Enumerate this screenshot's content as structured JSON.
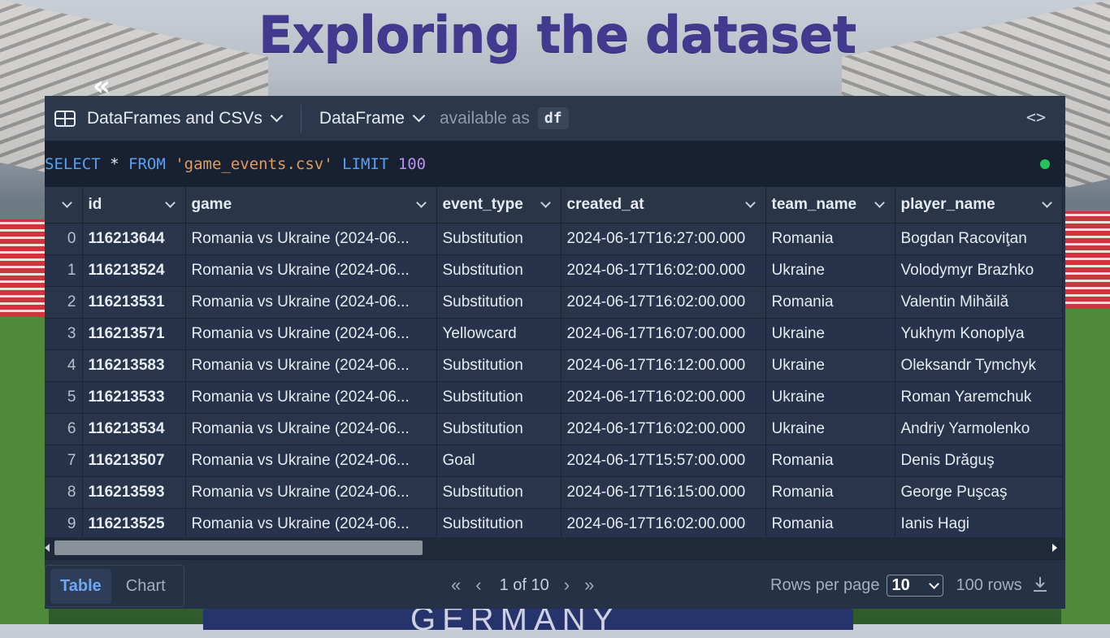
{
  "slide": {
    "title": "Exploring the dataset",
    "background_text": "GERMANY"
  },
  "toolbar": {
    "source_label": "DataFrames and CSVs",
    "output_label": "DataFrame",
    "available_as_label": "available as",
    "variable_name": "df",
    "code_toggle": "<>"
  },
  "query": {
    "select": "SELECT",
    "star": "*",
    "from": "FROM",
    "table": "'game_events.csv'",
    "limit": "LIMIT",
    "limit_value": "100",
    "status_color": "#23c45a"
  },
  "table": {
    "columns": [
      "id",
      "game",
      "event_type",
      "created_at",
      "team_name",
      "player_name"
    ],
    "rows": [
      {
        "index": "0",
        "id": "116213644",
        "game": "Romania vs Ukraine (2024-06...",
        "event_type": "Substitution",
        "created_at": "2024-06-17T16:27:00.000",
        "team_name": "Romania",
        "player_name": "Bogdan Racoviţan"
      },
      {
        "index": "1",
        "id": "116213524",
        "game": "Romania vs Ukraine (2024-06...",
        "event_type": "Substitution",
        "created_at": "2024-06-17T16:02:00.000",
        "team_name": "Ukraine",
        "player_name": "Volodymyr Brazhko"
      },
      {
        "index": "2",
        "id": "116213531",
        "game": "Romania vs Ukraine (2024-06...",
        "event_type": "Substitution",
        "created_at": "2024-06-17T16:02:00.000",
        "team_name": "Romania",
        "player_name": "Valentin Mihăilă"
      },
      {
        "index": "3",
        "id": "116213571",
        "game": "Romania vs Ukraine (2024-06...",
        "event_type": "Yellowcard",
        "created_at": "2024-06-17T16:07:00.000",
        "team_name": "Ukraine",
        "player_name": "Yukhym Konoplya"
      },
      {
        "index": "4",
        "id": "116213583",
        "game": "Romania vs Ukraine (2024-06...",
        "event_type": "Substitution",
        "created_at": "2024-06-17T16:12:00.000",
        "team_name": "Ukraine",
        "player_name": "Oleksandr Tymchyk"
      },
      {
        "index": "5",
        "id": "116213533",
        "game": "Romania vs Ukraine (2024-06...",
        "event_type": "Substitution",
        "created_at": "2024-06-17T16:02:00.000",
        "team_name": "Ukraine",
        "player_name": "Roman Yaremchuk"
      },
      {
        "index": "6",
        "id": "116213534",
        "game": "Romania vs Ukraine (2024-06...",
        "event_type": "Substitution",
        "created_at": "2024-06-17T16:02:00.000",
        "team_name": "Ukraine",
        "player_name": "Andriy Yarmolenko"
      },
      {
        "index": "7",
        "id": "116213507",
        "game": "Romania vs Ukraine (2024-06...",
        "event_type": "Goal",
        "created_at": "2024-06-17T15:57:00.000",
        "team_name": "Romania",
        "player_name": "Denis Drăguş"
      },
      {
        "index": "8",
        "id": "116213593",
        "game": "Romania vs Ukraine (2024-06...",
        "event_type": "Substitution",
        "created_at": "2024-06-17T16:15:00.000",
        "team_name": "Romania",
        "player_name": "George Puşcaş"
      },
      {
        "index": "9",
        "id": "116213525",
        "game": "Romania vs Ukraine (2024-06...",
        "event_type": "Substitution",
        "created_at": "2024-06-17T16:02:00.000",
        "team_name": "Romania",
        "player_name": "Ianis Hagi"
      }
    ]
  },
  "footer": {
    "tab_table": "Table",
    "tab_chart": "Chart",
    "page_indicator": "1 of 10",
    "rows_per_page_label": "Rows per page",
    "rows_per_page_value": "10",
    "row_count": "100 rows"
  },
  "icons": {
    "table": "table-icon",
    "back": "chevron-left-double-icon",
    "download": "download-icon"
  },
  "colors": {
    "title": "#433a8f",
    "panel_bg": "#253144",
    "accent": "#6ea8f5"
  }
}
